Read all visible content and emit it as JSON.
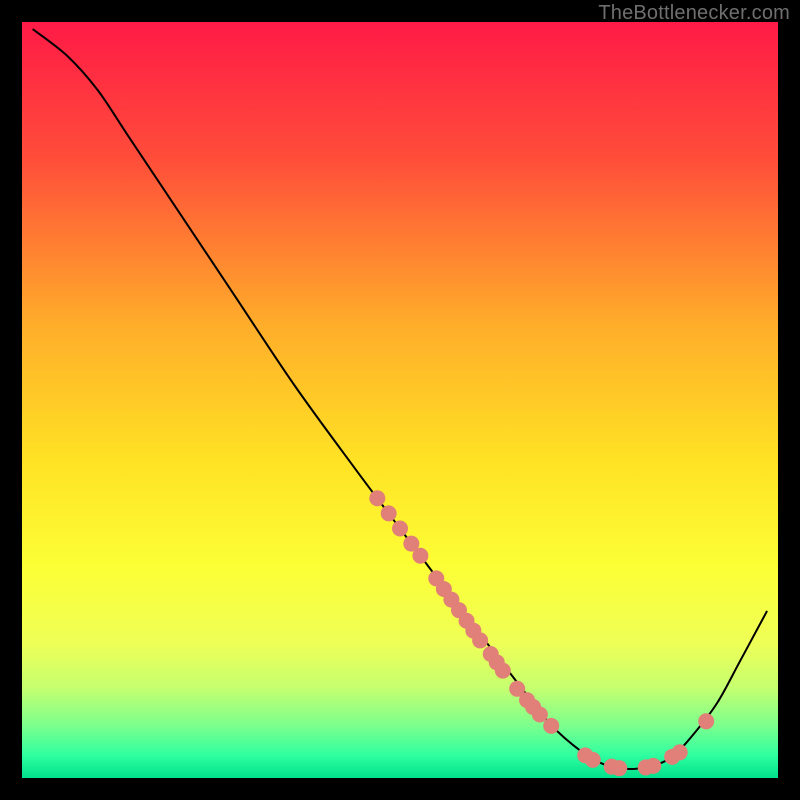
{
  "watermark": "TheBottlenecker.com",
  "chart_data": {
    "type": "line",
    "title": "",
    "xlabel": "",
    "ylabel": "",
    "xlim": [
      0,
      100
    ],
    "ylim": [
      0,
      100
    ],
    "background_gradient": {
      "stops": [
        {
          "offset": 0,
          "color": "#ff1a46"
        },
        {
          "offset": 18,
          "color": "#ff4d3a"
        },
        {
          "offset": 40,
          "color": "#ffad2a"
        },
        {
          "offset": 58,
          "color": "#ffe224"
        },
        {
          "offset": 72,
          "color": "#fcff35"
        },
        {
          "offset": 82,
          "color": "#efff56"
        },
        {
          "offset": 88,
          "color": "#c6ff6f"
        },
        {
          "offset": 93,
          "color": "#7dff8d"
        },
        {
          "offset": 97,
          "color": "#2fffa0"
        },
        {
          "offset": 100,
          "color": "#00e08c"
        }
      ]
    },
    "series": [
      {
        "name": "bottleneck-curve",
        "stroke": "#000000",
        "stroke_width": 2,
        "points": [
          {
            "x": 1.5,
            "y": 99.0
          },
          {
            "x": 6.0,
            "y": 95.5
          },
          {
            "x": 10.0,
            "y": 91.0
          },
          {
            "x": 14.0,
            "y": 85.0
          },
          {
            "x": 20.0,
            "y": 76.0
          },
          {
            "x": 28.0,
            "y": 64.0
          },
          {
            "x": 36.0,
            "y": 52.0
          },
          {
            "x": 44.0,
            "y": 41.0
          },
          {
            "x": 50.0,
            "y": 33.0
          },
          {
            "x": 56.0,
            "y": 25.0
          },
          {
            "x": 61.0,
            "y": 18.5
          },
          {
            "x": 66.0,
            "y": 12.0
          },
          {
            "x": 70.0,
            "y": 7.0
          },
          {
            "x": 74.0,
            "y": 3.5
          },
          {
            "x": 77.0,
            "y": 1.8
          },
          {
            "x": 80.0,
            "y": 1.2
          },
          {
            "x": 83.0,
            "y": 1.5
          },
          {
            "x": 86.0,
            "y": 2.8
          },
          {
            "x": 89.0,
            "y": 6.0
          },
          {
            "x": 92.0,
            "y": 10.0
          },
          {
            "x": 95.0,
            "y": 15.5
          },
          {
            "x": 98.5,
            "y": 22.0
          }
        ]
      }
    ],
    "data_dots": {
      "color": "#e08078",
      "radius": 8,
      "points": [
        {
          "x": 47.0,
          "y": 37.0
        },
        {
          "x": 48.5,
          "y": 35.0
        },
        {
          "x": 50.0,
          "y": 33.0
        },
        {
          "x": 51.5,
          "y": 31.0
        },
        {
          "x": 52.7,
          "y": 29.4
        },
        {
          "x": 54.8,
          "y": 26.4
        },
        {
          "x": 55.8,
          "y": 25.0
        },
        {
          "x": 56.8,
          "y": 23.6
        },
        {
          "x": 57.8,
          "y": 22.2
        },
        {
          "x": 58.8,
          "y": 20.8
        },
        {
          "x": 59.7,
          "y": 19.5
        },
        {
          "x": 60.6,
          "y": 18.2
        },
        {
          "x": 62.0,
          "y": 16.4
        },
        {
          "x": 62.8,
          "y": 15.3
        },
        {
          "x": 63.6,
          "y": 14.2
        },
        {
          "x": 65.5,
          "y": 11.8
        },
        {
          "x": 66.8,
          "y": 10.3
        },
        {
          "x": 67.6,
          "y": 9.4
        },
        {
          "x": 68.5,
          "y": 8.4
        },
        {
          "x": 70.0,
          "y": 6.9
        },
        {
          "x": 74.5,
          "y": 3.0
        },
        {
          "x": 75.5,
          "y": 2.4
        },
        {
          "x": 78.0,
          "y": 1.5
        },
        {
          "x": 79.0,
          "y": 1.3
        },
        {
          "x": 82.5,
          "y": 1.4
        },
        {
          "x": 83.5,
          "y": 1.6
        },
        {
          "x": 86.0,
          "y": 2.8
        },
        {
          "x": 87.0,
          "y": 3.4
        },
        {
          "x": 90.5,
          "y": 7.5
        }
      ]
    }
  }
}
